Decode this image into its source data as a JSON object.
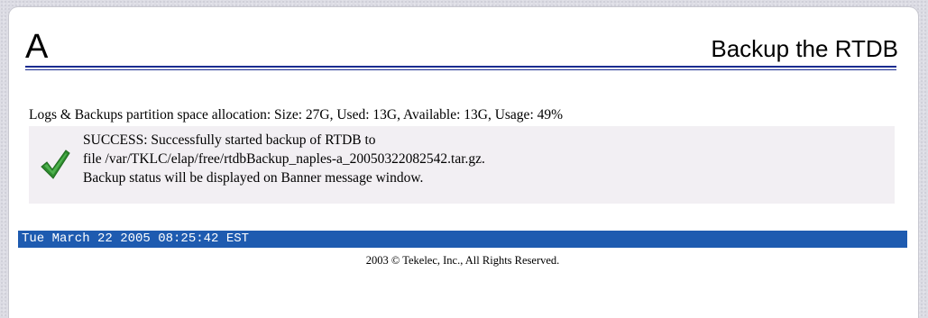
{
  "header": {
    "letter": "A",
    "title": "Backup the RTDB",
    "rule_color": "#1a2b8f"
  },
  "partition": {
    "text": "Logs & Backups partition space allocation: Size: 27G, Used: 13G, Available: 13G, Usage: 49%"
  },
  "message": {
    "icon": "green-checkmark-icon",
    "icon_color": "#2e8b2e",
    "lines": [
      "SUCCESS: Successfully started backup of RTDB to",
      "file /var/TKLC/elap/free/rtdbBackup_naples-a_20050322082542.tar.gz.",
      "Backup status will be displayed on Banner message window."
    ]
  },
  "status_bar": {
    "timestamp": "Tue March 22 2005 08:25:42 EST",
    "background": "#1e5bb0"
  },
  "footer": {
    "copyright": "2003 © Tekelec, Inc., All Rights Reserved."
  }
}
